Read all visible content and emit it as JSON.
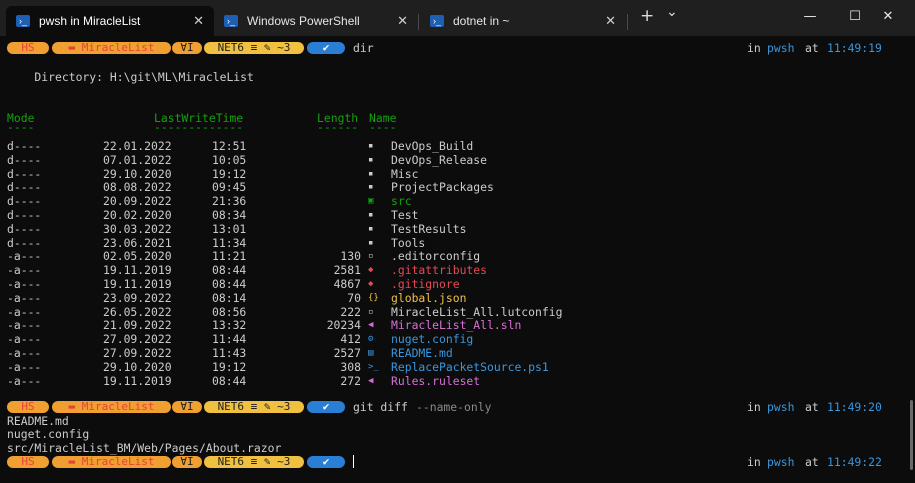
{
  "tabs": [
    {
      "title": "pwsh in MiracleList",
      "active": true
    },
    {
      "title": "Windows PowerShell",
      "active": false
    },
    {
      "title": "dotnet in ~",
      "active": false
    }
  ],
  "toolbar": {
    "new_tab": "+",
    "dropdown": "⌄",
    "minimize": "—",
    "maximize": "☐",
    "close": "✕",
    "tab_close": "✕"
  },
  "prompt": {
    "user": "HS",
    "folder": "MiracleList",
    "git_icon": "ⱯI",
    "branch": "NET6 ≡ ✎ ~3",
    "check": "✔"
  },
  "commands": [
    {
      "cmd": "dir",
      "args": "",
      "time": "11:49:19"
    },
    {
      "cmd": "git diff",
      "args": "--name-only",
      "time": "11:49:20"
    },
    {
      "cmd": "",
      "args": "",
      "time": "11:49:22"
    }
  ],
  "right_prefix": "in",
  "right_shell": "pwsh",
  "right_at": "at",
  "directory_line": "    Directory: H:\\git\\ML\\MiracleList",
  "headers": {
    "mode": "Mode",
    "time": "LastWriteTime",
    "length": "Length",
    "name": "Name",
    "mode_u": "----",
    "time_u": "-------------",
    "length_u": "------",
    "name_u": "----"
  },
  "rows": [
    {
      "mode": "d----",
      "date": "22.01.2022",
      "time": "12:51",
      "length": "",
      "icon": "▪",
      "name": "DevOps_Build",
      "color": "#cccccc"
    },
    {
      "mode": "d----",
      "date": "07.01.2022",
      "time": "10:05",
      "length": "",
      "icon": "▪",
      "name": "DevOps_Release",
      "color": "#cccccc"
    },
    {
      "mode": "d----",
      "date": "29.10.2020",
      "time": "19:12",
      "length": "",
      "icon": "▪",
      "name": "Misc",
      "color": "#cccccc"
    },
    {
      "mode": "d----",
      "date": "08.08.2022",
      "time": "09:45",
      "length": "",
      "icon": "▪",
      "name": "ProjectPackages",
      "color": "#cccccc"
    },
    {
      "mode": "d----",
      "date": "20.09.2022",
      "time": "21:36",
      "length": "",
      "icon": "▣",
      "name": "src",
      "color": "#13a10e"
    },
    {
      "mode": "d----",
      "date": "20.02.2020",
      "time": "08:34",
      "length": "",
      "icon": "▪",
      "name": "Test",
      "color": "#cccccc"
    },
    {
      "mode": "d----",
      "date": "30.03.2022",
      "time": "13:01",
      "length": "",
      "icon": "▪",
      "name": "TestResults",
      "color": "#cccccc"
    },
    {
      "mode": "d----",
      "date": "23.06.2021",
      "time": "11:34",
      "length": "",
      "icon": "▪",
      "name": "Tools",
      "color": "#cccccc"
    },
    {
      "mode": "-a---",
      "date": "02.05.2020",
      "time": "11:21",
      "length": "130",
      "icon": "▫",
      "name": ".editorconfig",
      "color": "#cccccc"
    },
    {
      "mode": "-a---",
      "date": "19.11.2019",
      "time": "08:44",
      "length": "2581",
      "icon": "◆",
      "name": ".gitattributes",
      "color": "#e74856"
    },
    {
      "mode": "-a---",
      "date": "19.11.2019",
      "time": "08:44",
      "length": "4867",
      "icon": "◆",
      "name": ".gitignore",
      "color": "#e74856"
    },
    {
      "mode": "-a---",
      "date": "23.09.2022",
      "time": "08:14",
      "length": "70",
      "icon": "{}",
      "name": "global.json",
      "color": "#f0c040"
    },
    {
      "mode": "-a---",
      "date": "26.05.2022",
      "time": "08:56",
      "length": "222",
      "icon": "▫",
      "name": "MiracleList_All.lutconfig",
      "color": "#cccccc"
    },
    {
      "mode": "-a---",
      "date": "21.09.2022",
      "time": "13:32",
      "length": "20234",
      "icon": "◀",
      "name": "MiracleList_All.sln",
      "color": "#d670d6"
    },
    {
      "mode": "-a---",
      "date": "27.09.2022",
      "time": "11:44",
      "length": "412",
      "icon": "⚙",
      "name": "nuget.config",
      "color": "#3a96dd"
    },
    {
      "mode": "-a---",
      "date": "27.09.2022",
      "time": "11:43",
      "length": "2527",
      "icon": "▤",
      "name": "README.md",
      "color": "#3a96dd"
    },
    {
      "mode": "-a---",
      "date": "29.10.2020",
      "time": "19:12",
      "length": "308",
      "icon": ">_",
      "name": "ReplacePacketSource.ps1",
      "color": "#3a96dd"
    },
    {
      "mode": "-a---",
      "date": "19.11.2019",
      "time": "08:44",
      "length": "272",
      "icon": "◀",
      "name": "Rules.ruleset",
      "color": "#d670d6"
    }
  ],
  "diff_output": [
    "README.md",
    "nuget.config",
    "src/MiracleList_BM/Web/Pages/About.razor"
  ]
}
